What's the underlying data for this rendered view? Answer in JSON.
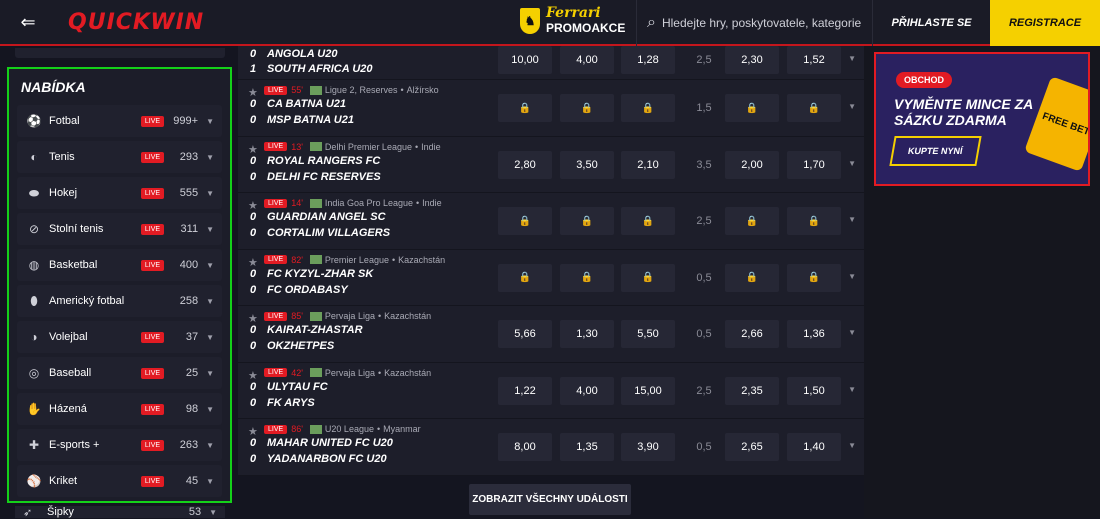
{
  "header": {
    "logo": "QUICKWIN",
    "promo_brand": "Ferrari",
    "promo_label": "PROMOAKCE",
    "search_placeholder": "Hledejte hry, poskytovatele, kategorie",
    "login_label": "PŘIHLASTE SE",
    "register_label": "REGISTRACE"
  },
  "sidebar": {
    "title": "NABÍDKA",
    "live_label": "LIVE",
    "items": [
      {
        "label": "Fotbal",
        "count": "999+",
        "live": true,
        "icon": "soccer-ball-icon"
      },
      {
        "label": "Tenis",
        "count": "293",
        "live": true,
        "icon": "tennis-icon"
      },
      {
        "label": "Hokej",
        "count": "555",
        "live": true,
        "icon": "hockey-icon"
      },
      {
        "label": "Stolní tenis",
        "count": "311",
        "live": true,
        "icon": "table-tennis-icon"
      },
      {
        "label": "Basketbal",
        "count": "400",
        "live": true,
        "icon": "basketball-icon"
      },
      {
        "label": "Americký fotbal",
        "count": "258",
        "live": false,
        "icon": "american-football-icon"
      },
      {
        "label": "Volejbal",
        "count": "37",
        "live": true,
        "icon": "volleyball-icon"
      },
      {
        "label": "Baseball",
        "count": "25",
        "live": true,
        "icon": "baseball-icon"
      },
      {
        "label": "Házená",
        "count": "98",
        "live": true,
        "icon": "handball-icon"
      },
      {
        "label": "E-sports +",
        "count": "263",
        "live": true,
        "icon": "gamepad-icon"
      },
      {
        "label": "Kriket",
        "count": "45",
        "live": true,
        "icon": "cricket-icon"
      }
    ],
    "partial_item": {
      "label": "Šipky",
      "count": "53"
    }
  },
  "events": [
    {
      "minute": "",
      "league": "",
      "country": "",
      "teams": [
        "ANGOLA U20",
        "SOUTH AFRICA U20"
      ],
      "scores": [
        "0",
        "1"
      ],
      "odds": [
        "10,00",
        "4,00",
        "1,28"
      ],
      "line": "2,5",
      "totals": [
        "2,30",
        "1,52"
      ],
      "locked": false,
      "partial": true
    },
    {
      "minute": "55'",
      "league": "Ligue 2, Reserves",
      "country": "Alžírsko",
      "teams": [
        "CA BATNA U21",
        "MSP BATNA U21"
      ],
      "scores": [
        "0",
        "0"
      ],
      "odds": [
        "",
        "",
        ""
      ],
      "line": "1,5",
      "totals": [
        "",
        ""
      ],
      "locked": true
    },
    {
      "minute": "13'",
      "league": "Delhi Premier League",
      "country": "Indie",
      "teams": [
        "ROYAL RANGERS FC",
        "DELHI FC RESERVES"
      ],
      "scores": [
        "0",
        "0"
      ],
      "odds": [
        "2,80",
        "3,50",
        "2,10"
      ],
      "line": "3,5",
      "totals": [
        "2,00",
        "1,70"
      ],
      "locked": false
    },
    {
      "minute": "14'",
      "league": "India Goa Pro League",
      "country": "Indie",
      "teams": [
        "GUARDIAN ANGEL SC",
        "CORTALIM VILLAGERS"
      ],
      "scores": [
        "0",
        "0"
      ],
      "odds": [
        "",
        "",
        ""
      ],
      "line": "2,5",
      "totals": [
        "",
        ""
      ],
      "locked": true
    },
    {
      "minute": "82'",
      "league": "Premier League",
      "country": "Kazachstán",
      "teams": [
        "FC KYZYL-ZHAR SK",
        "FC ORDABASY"
      ],
      "scores": [
        "0",
        "0"
      ],
      "odds": [
        "",
        "",
        ""
      ],
      "line": "0,5",
      "totals": [
        "",
        ""
      ],
      "locked": true
    },
    {
      "minute": "85'",
      "league": "Pervaja Liga",
      "country": "Kazachstán",
      "teams": [
        "KAIRAT-ZHASTAR",
        "OKZHETPES"
      ],
      "scores": [
        "0",
        "0"
      ],
      "odds": [
        "5,66",
        "1,30",
        "5,50"
      ],
      "line": "0,5",
      "totals": [
        "2,66",
        "1,36"
      ],
      "locked": false
    },
    {
      "minute": "42'",
      "league": "Pervaja Liga",
      "country": "Kazachstán",
      "teams": [
        "ULYTAU FC",
        "FK ARYS"
      ],
      "scores": [
        "0",
        "0"
      ],
      "odds": [
        "1,22",
        "4,00",
        "15,00"
      ],
      "line": "2,5",
      "totals": [
        "2,35",
        "1,50"
      ],
      "locked": false
    },
    {
      "minute": "86'",
      "league": "U20 League",
      "country": "Myanmar",
      "teams": [
        "MAHAR UNITED FC U20",
        "YADANARBON FC U20"
      ],
      "scores": [
        "0",
        "0"
      ],
      "odds": [
        "8,00",
        "1,35",
        "3,90"
      ],
      "line": "0,5",
      "totals": [
        "2,65",
        "1,40"
      ],
      "locked": false
    }
  ],
  "show_all_label": "ZOBRAZIT VŠECHNY UDÁLOSTI",
  "banner": {
    "tag": "OBCHOD",
    "headline": "VYMĚNTE MINCE ZA SÁZKU ZDARMA",
    "cta": "KUPTE NYNÍ",
    "badge": "FREE BET"
  }
}
